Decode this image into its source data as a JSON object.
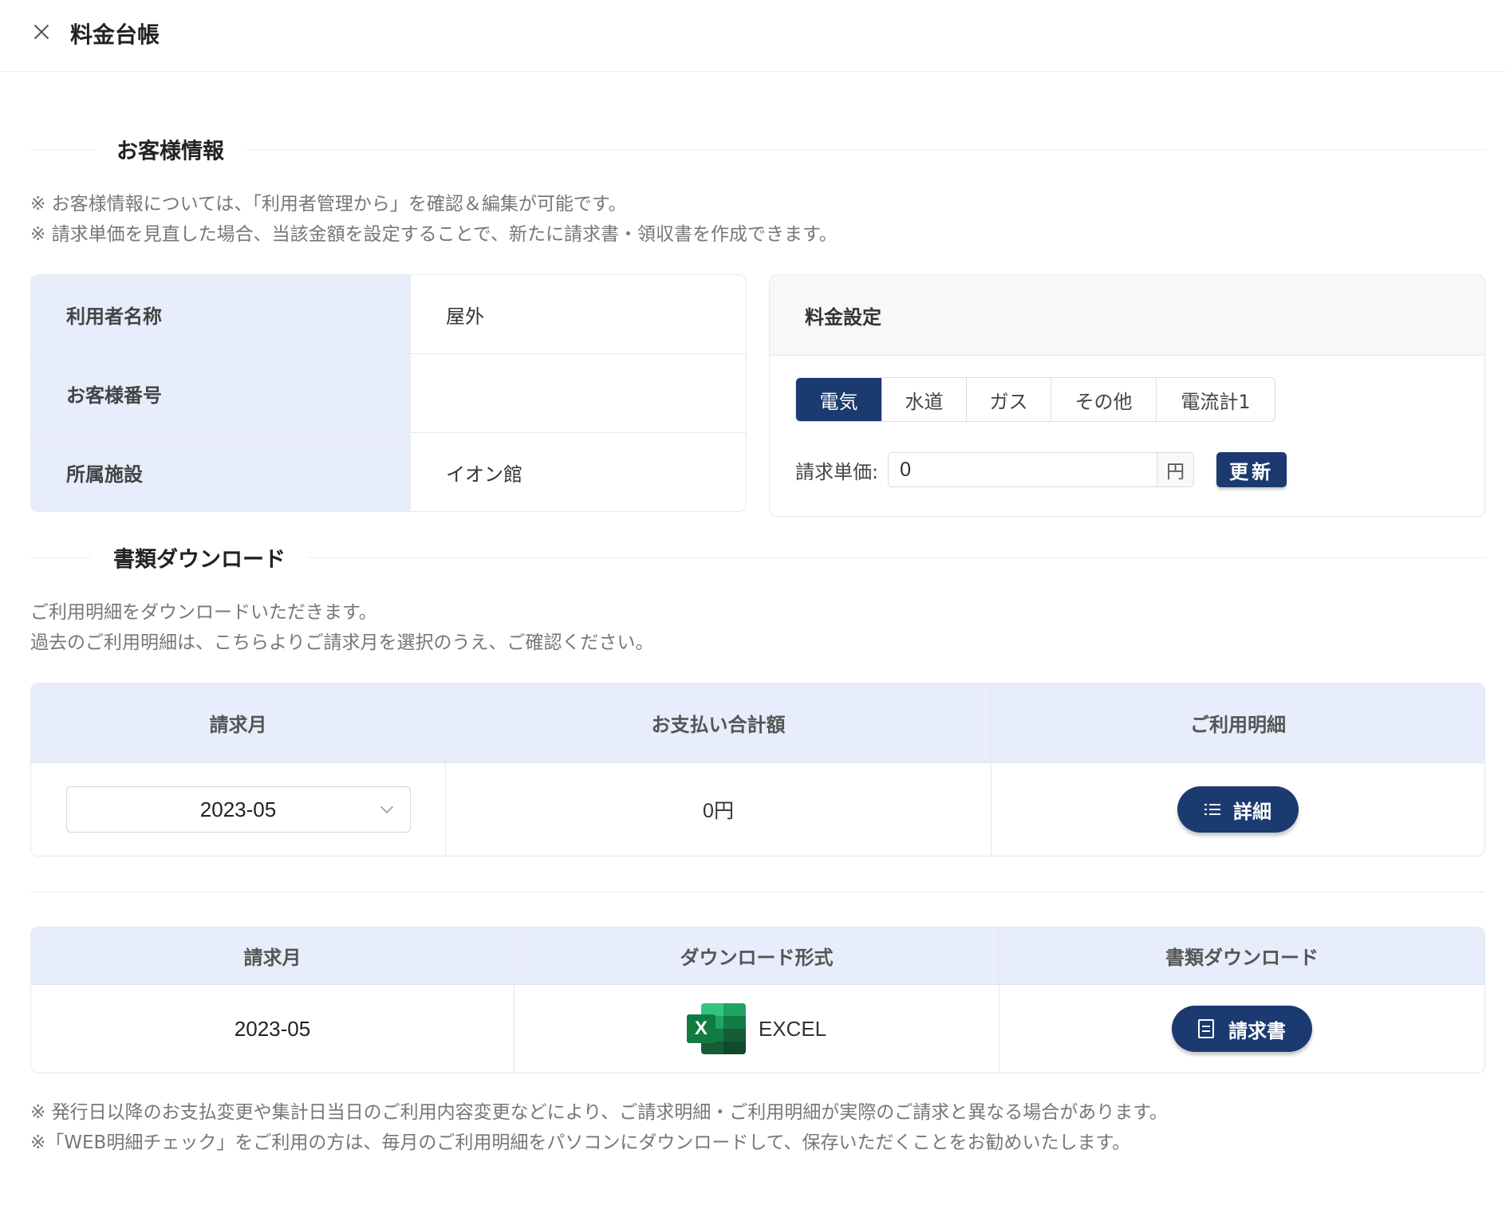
{
  "header": {
    "title": "料金台帳"
  },
  "customer_section": {
    "title": "お客様情報",
    "notes": [
      "※ お客様情報については、「利用者管理から」を確認＆編集が可能です。",
      "※ 請求単価を見直した場合、当該金額を設定することで、新たに請求書・領収書を作成できます。"
    ],
    "info_rows": [
      {
        "label": "利用者名称",
        "value": "屋外"
      },
      {
        "label": "お客様番号",
        "value": ""
      },
      {
        "label": "所属施設",
        "value": "イオン館"
      }
    ]
  },
  "fee_settings": {
    "title": "料金設定",
    "tabs": [
      "電気",
      "水道",
      "ガス",
      "その他",
      "電流計1"
    ],
    "active_tab": "電気",
    "unit_price_label": "請求単価:",
    "unit_price_value": "0",
    "unit": "円",
    "update_button": "更新"
  },
  "download_section": {
    "title": "書類ダウンロード",
    "notes": [
      "ご利用明細をダウンロードいただきます。",
      "過去のご利用明細は、こちらよりご請求月を選択のうえ、ご確認ください。"
    ]
  },
  "usage_table": {
    "headers": [
      "請求月",
      "お支払い合計額",
      "ご利用明細"
    ],
    "selected_month": "2023-05",
    "total_amount": "0円",
    "detail_button": "詳細"
  },
  "download_table": {
    "headers": [
      "請求月",
      "ダウンロード形式",
      "書類ダウンロード"
    ],
    "month": "2023-05",
    "format": "EXCEL",
    "format_icon": "excel-icon",
    "invoice_button": "請求書"
  },
  "footer_notes": [
    "※ 発行日以降のお支払変更や集計日当日のご利用内容変更などにより、ご請求明細・ご利用明細が実際のご請求と異なる場合があります。",
    "※「WEB明細チェック」をご利用の方は、毎月のご利用明細をパソコンにダウンロードして、保存いただくことをお勧めいたします。"
  ],
  "colors": {
    "accent": "#1b3a6f",
    "label_bg": "#e7edfa",
    "excel_green": "#107c41"
  }
}
